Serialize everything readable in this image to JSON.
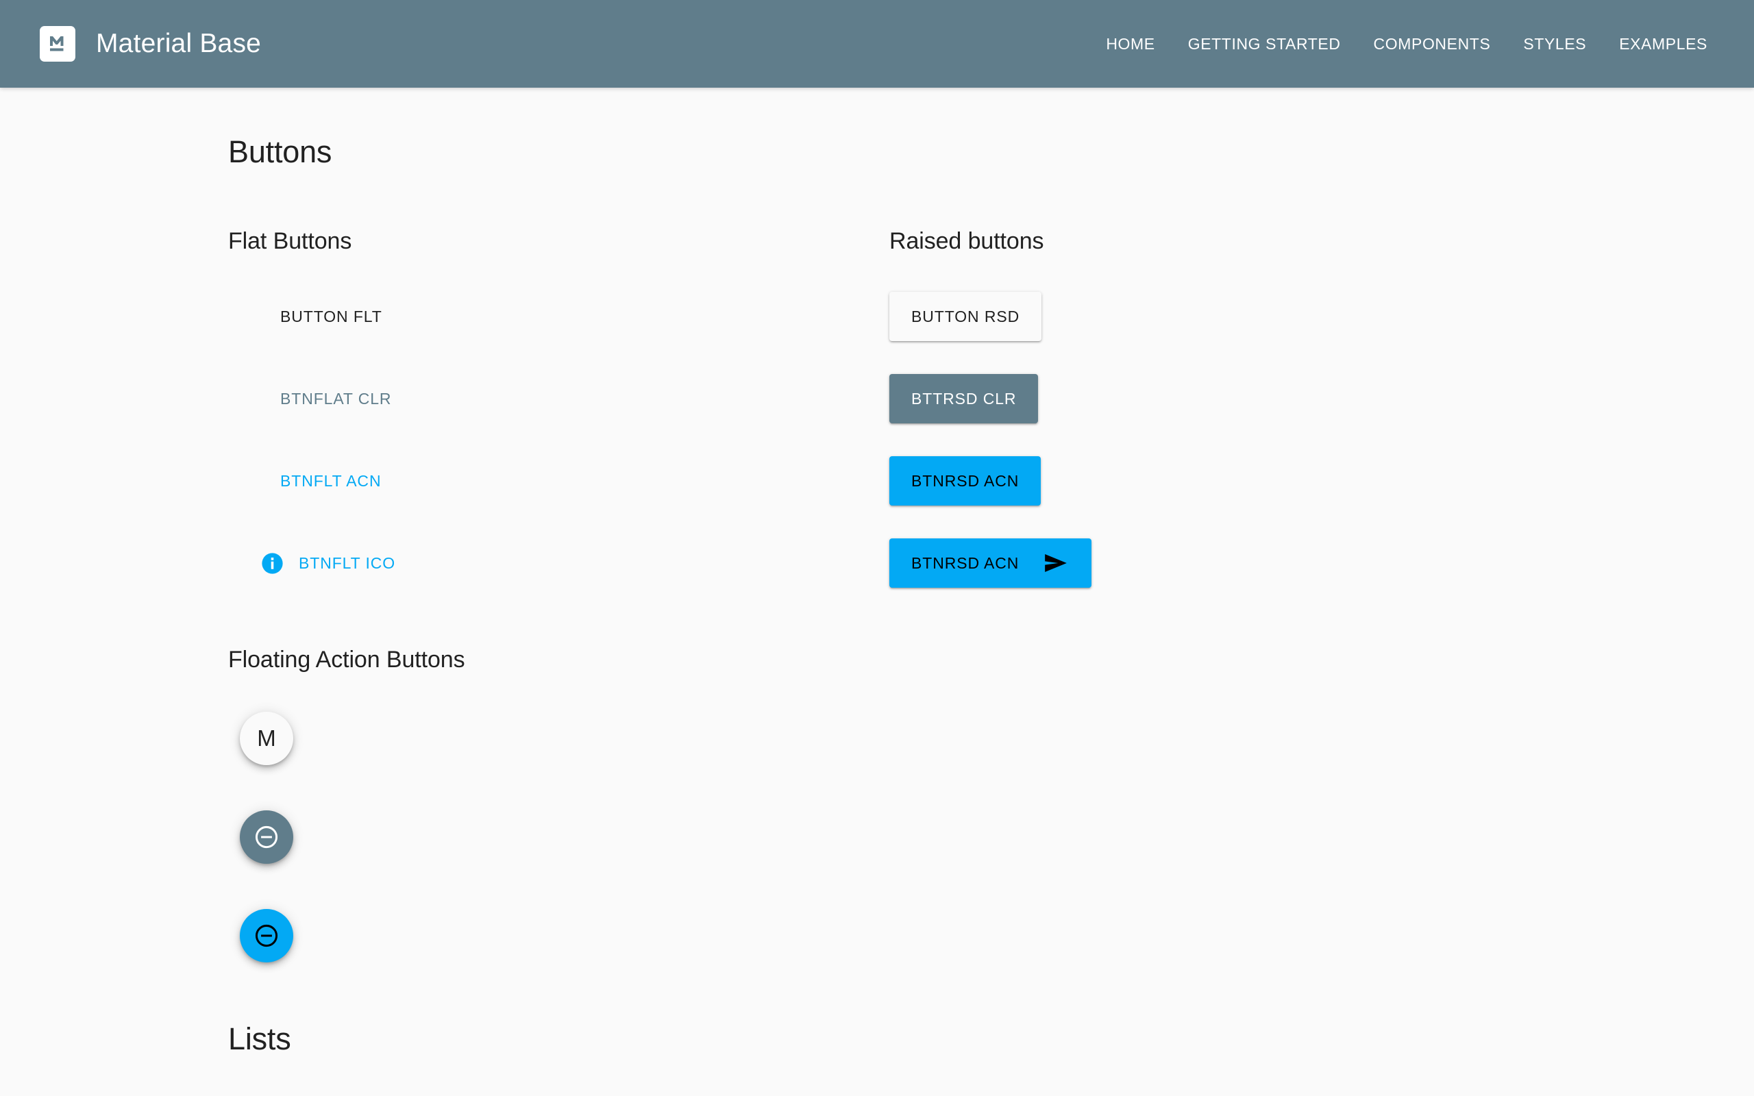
{
  "header": {
    "logo_icon": "material-m-logo-icon",
    "title": "Material Base",
    "nav": [
      {
        "label": "HOME"
      },
      {
        "label": "GETTING STARTED"
      },
      {
        "label": "COMPONENTS"
      },
      {
        "label": "STYLES"
      },
      {
        "label": "EXAMPLES"
      }
    ]
  },
  "main": {
    "page_title": "Buttons",
    "sections": {
      "flat": {
        "heading": "Flat Buttons",
        "buttons": [
          {
            "label": "BUTTON FLT"
          },
          {
            "label": "BTNFLAT CLR"
          },
          {
            "label": "BTNFLT ACN"
          },
          {
            "label": "BTNFLT ICO",
            "icon": "info-icon"
          }
        ]
      },
      "raised": {
        "heading": "Raised buttons",
        "buttons": [
          {
            "label": "BUTTON RSD"
          },
          {
            "label": "BTTRSD CLR"
          },
          {
            "label": "BTNRSD ACN"
          },
          {
            "label": "BTNRSD ACN",
            "icon": "send-icon"
          }
        ]
      },
      "fab": {
        "heading": "Floating Action Buttons",
        "buttons": [
          {
            "label": "M",
            "icon": ""
          },
          {
            "label": "",
            "icon": "remove-circle-outline-icon"
          },
          {
            "label": "",
            "icon": "remove-circle-outline-icon"
          }
        ]
      }
    },
    "lists_title": "Lists"
  },
  "colors": {
    "primary": "#607d8b",
    "accent": "#03a9f4",
    "background": "#fafafa",
    "text": "#212121",
    "on_primary": "#ffffff"
  }
}
